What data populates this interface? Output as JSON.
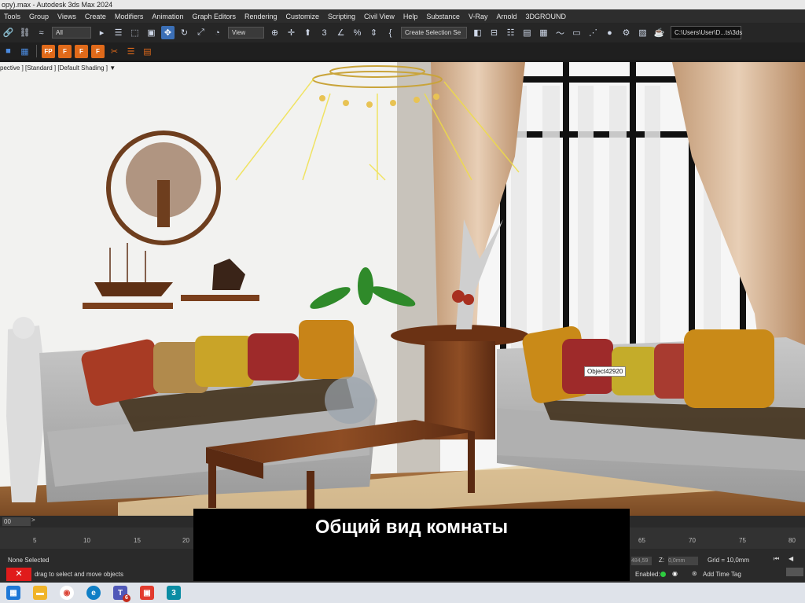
{
  "window": {
    "title": "opy).max - Autodesk 3ds Max 2024"
  },
  "menu": [
    "Tools",
    "Group",
    "Views",
    "Create",
    "Modifiers",
    "Animation",
    "Graph Editors",
    "Rendering",
    "Customize",
    "Scripting",
    "Civil View",
    "Help",
    "Substance",
    "V-Ray",
    "Arnold",
    "3DGROUND"
  ],
  "toolbar": {
    "filter_value": "All",
    "view_value": "View",
    "selection_set_placeholder": "Create Selection Se",
    "project_path": "C:\\Users\\User\\D...ts\\3ds"
  },
  "toolbar2": {
    "buttons": [
      "FP",
      "F",
      "F",
      "F"
    ]
  },
  "viewport": {
    "label": "pective ] [Standard ] [Default Shading ]",
    "tooltip": "Object42920"
  },
  "caption": {
    "text": "Общий вид комнаты"
  },
  "timeline": {
    "frame_value": "00",
    "ticks_left": [
      "5",
      "10",
      "15",
      "20"
    ],
    "ticks_right": [
      "65",
      "70",
      "75",
      "80"
    ]
  },
  "status": {
    "selection": "None Selected",
    "prompt": "drag to select and move objects",
    "x_value": "484,59",
    "z_label": "Z:",
    "z_value": "0,0mm",
    "grid": "Grid = 10,0mm",
    "enabled_label": "Enabled:",
    "add_time_tag": "Add Time Tag"
  },
  "taskbar": {
    "badge": "6",
    "max_label": "3"
  },
  "colors": {
    "accent": "#e06a1a",
    "ui_dark": "#2d2d2d",
    "caption_bg": "#000000"
  }
}
